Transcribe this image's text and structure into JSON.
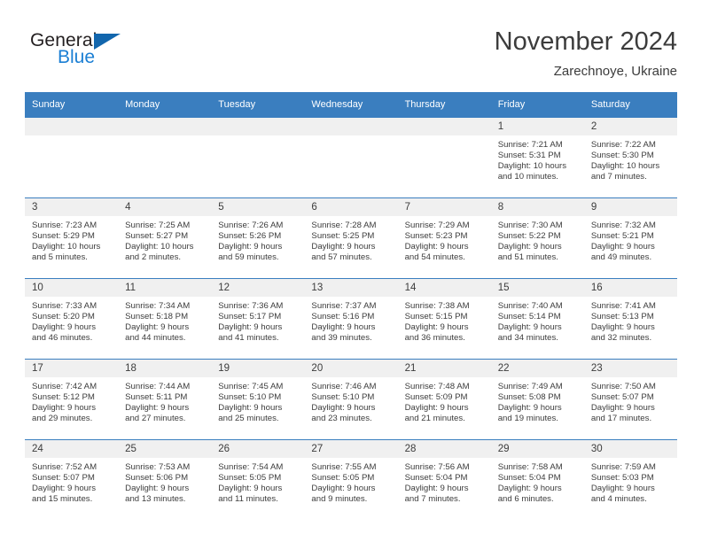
{
  "logo": {
    "word_one": "General",
    "word_two": "Blue",
    "triangle_icon": "triangle-icon",
    "brand_dark": "#231f20",
    "brand_blue": "#1b7fd4",
    "triangle_color": "#1266ad"
  },
  "header": {
    "title": "November 2024",
    "subtitle": "Zarechnoye, Ukraine"
  },
  "theme": {
    "header_bg": "#3a7ebf",
    "daynum_bg": "#f0f0f0",
    "text": "#3c3c3c"
  },
  "weekdays": [
    "Sunday",
    "Monday",
    "Tuesday",
    "Wednesday",
    "Thursday",
    "Friday",
    "Saturday"
  ],
  "weeks": [
    [
      {
        "day": "",
        "empty": true
      },
      {
        "day": "",
        "empty": true
      },
      {
        "day": "",
        "empty": true
      },
      {
        "day": "",
        "empty": true
      },
      {
        "day": "",
        "empty": true
      },
      {
        "day": "1",
        "sunrise": "Sunrise: 7:21 AM",
        "sunset": "Sunset: 5:31 PM",
        "daylight_1": "Daylight: 10 hours",
        "daylight_2": "and 10 minutes."
      },
      {
        "day": "2",
        "sunrise": "Sunrise: 7:22 AM",
        "sunset": "Sunset: 5:30 PM",
        "daylight_1": "Daylight: 10 hours",
        "daylight_2": "and 7 minutes."
      }
    ],
    [
      {
        "day": "3",
        "sunrise": "Sunrise: 7:23 AM",
        "sunset": "Sunset: 5:29 PM",
        "daylight_1": "Daylight: 10 hours",
        "daylight_2": "and 5 minutes."
      },
      {
        "day": "4",
        "sunrise": "Sunrise: 7:25 AM",
        "sunset": "Sunset: 5:27 PM",
        "daylight_1": "Daylight: 10 hours",
        "daylight_2": "and 2 minutes."
      },
      {
        "day": "5",
        "sunrise": "Sunrise: 7:26 AM",
        "sunset": "Sunset: 5:26 PM",
        "daylight_1": "Daylight: 9 hours",
        "daylight_2": "and 59 minutes."
      },
      {
        "day": "6",
        "sunrise": "Sunrise: 7:28 AM",
        "sunset": "Sunset: 5:25 PM",
        "daylight_1": "Daylight: 9 hours",
        "daylight_2": "and 57 minutes."
      },
      {
        "day": "7",
        "sunrise": "Sunrise: 7:29 AM",
        "sunset": "Sunset: 5:23 PM",
        "daylight_1": "Daylight: 9 hours",
        "daylight_2": "and 54 minutes."
      },
      {
        "day": "8",
        "sunrise": "Sunrise: 7:30 AM",
        "sunset": "Sunset: 5:22 PM",
        "daylight_1": "Daylight: 9 hours",
        "daylight_2": "and 51 minutes."
      },
      {
        "day": "9",
        "sunrise": "Sunrise: 7:32 AM",
        "sunset": "Sunset: 5:21 PM",
        "daylight_1": "Daylight: 9 hours",
        "daylight_2": "and 49 minutes."
      }
    ],
    [
      {
        "day": "10",
        "sunrise": "Sunrise: 7:33 AM",
        "sunset": "Sunset: 5:20 PM",
        "daylight_1": "Daylight: 9 hours",
        "daylight_2": "and 46 minutes."
      },
      {
        "day": "11",
        "sunrise": "Sunrise: 7:34 AM",
        "sunset": "Sunset: 5:18 PM",
        "daylight_1": "Daylight: 9 hours",
        "daylight_2": "and 44 minutes."
      },
      {
        "day": "12",
        "sunrise": "Sunrise: 7:36 AM",
        "sunset": "Sunset: 5:17 PM",
        "daylight_1": "Daylight: 9 hours",
        "daylight_2": "and 41 minutes."
      },
      {
        "day": "13",
        "sunrise": "Sunrise: 7:37 AM",
        "sunset": "Sunset: 5:16 PM",
        "daylight_1": "Daylight: 9 hours",
        "daylight_2": "and 39 minutes."
      },
      {
        "day": "14",
        "sunrise": "Sunrise: 7:38 AM",
        "sunset": "Sunset: 5:15 PM",
        "daylight_1": "Daylight: 9 hours",
        "daylight_2": "and 36 minutes."
      },
      {
        "day": "15",
        "sunrise": "Sunrise: 7:40 AM",
        "sunset": "Sunset: 5:14 PM",
        "daylight_1": "Daylight: 9 hours",
        "daylight_2": "and 34 minutes."
      },
      {
        "day": "16",
        "sunrise": "Sunrise: 7:41 AM",
        "sunset": "Sunset: 5:13 PM",
        "daylight_1": "Daylight: 9 hours",
        "daylight_2": "and 32 minutes."
      }
    ],
    [
      {
        "day": "17",
        "sunrise": "Sunrise: 7:42 AM",
        "sunset": "Sunset: 5:12 PM",
        "daylight_1": "Daylight: 9 hours",
        "daylight_2": "and 29 minutes."
      },
      {
        "day": "18",
        "sunrise": "Sunrise: 7:44 AM",
        "sunset": "Sunset: 5:11 PM",
        "daylight_1": "Daylight: 9 hours",
        "daylight_2": "and 27 minutes."
      },
      {
        "day": "19",
        "sunrise": "Sunrise: 7:45 AM",
        "sunset": "Sunset: 5:10 PM",
        "daylight_1": "Daylight: 9 hours",
        "daylight_2": "and 25 minutes."
      },
      {
        "day": "20",
        "sunrise": "Sunrise: 7:46 AM",
        "sunset": "Sunset: 5:10 PM",
        "daylight_1": "Daylight: 9 hours",
        "daylight_2": "and 23 minutes."
      },
      {
        "day": "21",
        "sunrise": "Sunrise: 7:48 AM",
        "sunset": "Sunset: 5:09 PM",
        "daylight_1": "Daylight: 9 hours",
        "daylight_2": "and 21 minutes."
      },
      {
        "day": "22",
        "sunrise": "Sunrise: 7:49 AM",
        "sunset": "Sunset: 5:08 PM",
        "daylight_1": "Daylight: 9 hours",
        "daylight_2": "and 19 minutes."
      },
      {
        "day": "23",
        "sunrise": "Sunrise: 7:50 AM",
        "sunset": "Sunset: 5:07 PM",
        "daylight_1": "Daylight: 9 hours",
        "daylight_2": "and 17 minutes."
      }
    ],
    [
      {
        "day": "24",
        "sunrise": "Sunrise: 7:52 AM",
        "sunset": "Sunset: 5:07 PM",
        "daylight_1": "Daylight: 9 hours",
        "daylight_2": "and 15 minutes."
      },
      {
        "day": "25",
        "sunrise": "Sunrise: 7:53 AM",
        "sunset": "Sunset: 5:06 PM",
        "daylight_1": "Daylight: 9 hours",
        "daylight_2": "and 13 minutes."
      },
      {
        "day": "26",
        "sunrise": "Sunrise: 7:54 AM",
        "sunset": "Sunset: 5:05 PM",
        "daylight_1": "Daylight: 9 hours",
        "daylight_2": "and 11 minutes."
      },
      {
        "day": "27",
        "sunrise": "Sunrise: 7:55 AM",
        "sunset": "Sunset: 5:05 PM",
        "daylight_1": "Daylight: 9 hours",
        "daylight_2": "and 9 minutes."
      },
      {
        "day": "28",
        "sunrise": "Sunrise: 7:56 AM",
        "sunset": "Sunset: 5:04 PM",
        "daylight_1": "Daylight: 9 hours",
        "daylight_2": "and 7 minutes."
      },
      {
        "day": "29",
        "sunrise": "Sunrise: 7:58 AM",
        "sunset": "Sunset: 5:04 PM",
        "daylight_1": "Daylight: 9 hours",
        "daylight_2": "and 6 minutes."
      },
      {
        "day": "30",
        "sunrise": "Sunrise: 7:59 AM",
        "sunset": "Sunset: 5:03 PM",
        "daylight_1": "Daylight: 9 hours",
        "daylight_2": "and 4 minutes."
      }
    ]
  ]
}
